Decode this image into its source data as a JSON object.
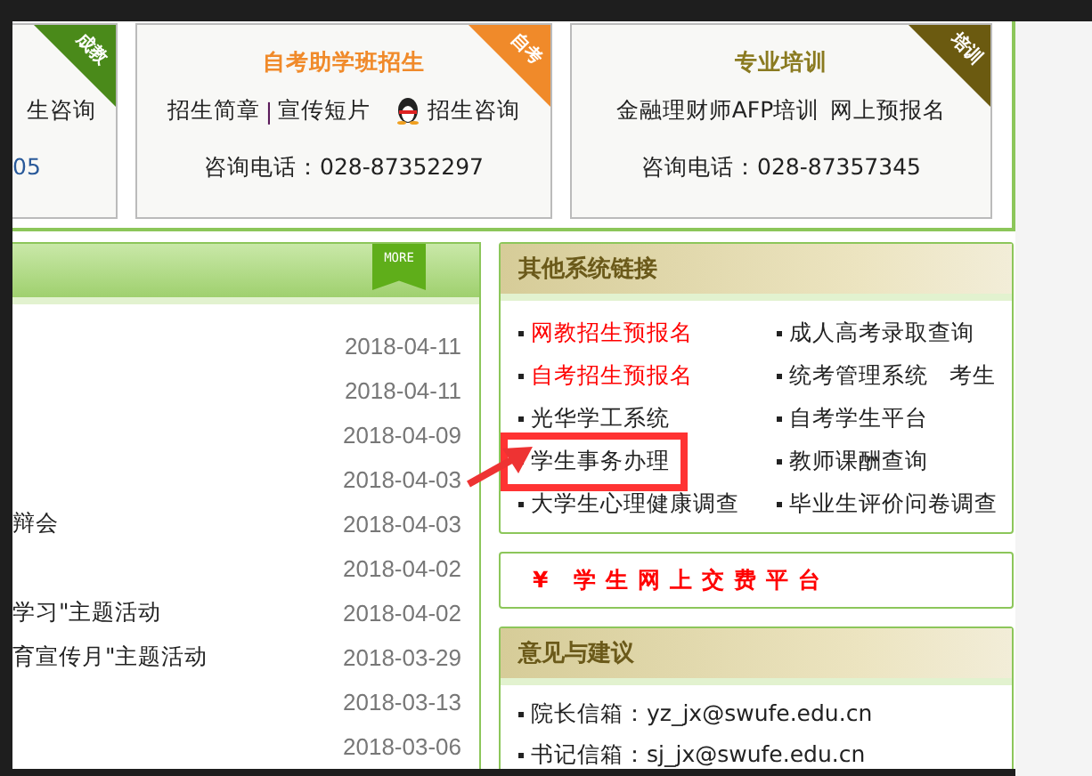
{
  "cards": [
    {
      "badge": "成教",
      "color": "#4a8a1a",
      "chat_link": "生咨询",
      "phone": "05"
    },
    {
      "badge": "自考",
      "color": "#f08a2a",
      "title": "自考助学班招生",
      "links": [
        {
          "kind": "link",
          "label": "招生简章"
        },
        {
          "kind": "separator",
          "label": "|"
        },
        {
          "kind": "link",
          "label": "宣传短片"
        }
      ],
      "chat_link": "招生咨询",
      "phone": "咨询电话：028-87352297"
    },
    {
      "badge": "培训",
      "color": "#6b5a10",
      "title": "专业培训",
      "links": [
        {
          "kind": "link",
          "label": "金融理财师AFP培训"
        },
        {
          "kind": "link",
          "label": "网上预报名"
        }
      ],
      "phone": "咨询电话：028-87357345"
    }
  ],
  "news": {
    "more": "MORE",
    "items": [
      {
        "date": "2018-04-11"
      },
      {
        "date": "2018-04-11"
      },
      {
        "date": "2018-04-09"
      },
      {
        "date": "2018-04-03"
      },
      {
        "title": "辩会",
        "date": "2018-04-03"
      },
      {
        "date": "2018-04-02"
      },
      {
        "title": "学习\"主题活动",
        "date": "2018-04-02"
      },
      {
        "title": "育宣传月\"主题活动",
        "date": "2018-03-29"
      },
      {
        "date": "2018-03-13"
      },
      {
        "date": "2018-03-06"
      }
    ]
  },
  "system_links": {
    "title": "其他系统链接",
    "rows": [
      {
        "left": {
          "label": "网教招生预报名",
          "color": "#ff0000",
          "highlighted": false
        },
        "right": {
          "label": "成人高考录取查询",
          "color": "#222222",
          "highlighted": false
        }
      },
      {
        "left": {
          "label": "自考招生预报名",
          "color": "#ff0000",
          "highlighted": false
        },
        "right": {
          "label": "统考管理系统",
          "color": "#222222",
          "highlighted": false,
          "extra": "考生"
        }
      },
      {
        "left": {
          "label": "光华学工系统",
          "color": "#222222",
          "highlighted": false
        },
        "right": {
          "label": "自考学生平台",
          "color": "#222222",
          "highlighted": false
        }
      },
      {
        "left": {
          "label": "学生事务办理",
          "color": "#222222",
          "highlighted": true
        },
        "right": {
          "label": "教师课酬查询",
          "color": "#222222",
          "highlighted": false
        }
      },
      {
        "left": {
          "label": "大学生心理健康调查",
          "color": "#222222",
          "highlighted": false
        },
        "right": {
          "label": "毕业生评价问卷调查",
          "color": "#222222",
          "highlighted": false
        }
      }
    ]
  },
  "payment_link": "¥ 学生网上交费平台",
  "feedback": {
    "title": "意见与建议",
    "items": [
      "院长信箱：yz_jx@swufe.edu.cn",
      "书记信箱：sj_jx@swufe.edu.cn"
    ]
  }
}
